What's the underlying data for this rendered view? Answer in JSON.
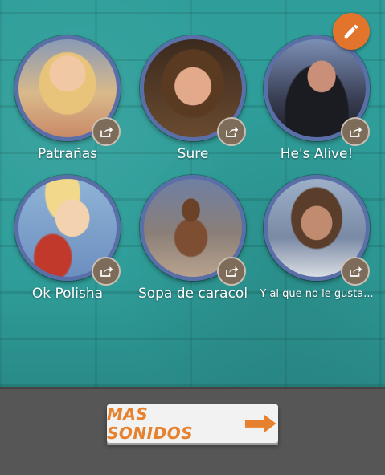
{
  "app": {
    "edit_icon": "pencil-icon",
    "accent": "#e2742b",
    "ring_color": "#5a6fa8",
    "wall_color": "#2f9e9a"
  },
  "sounds": [
    {
      "label": "Patrañas",
      "share_icon": "share-icon"
    },
    {
      "label": "Sure",
      "share_icon": "share-icon"
    },
    {
      "label": "He's Alive!",
      "share_icon": "share-icon"
    },
    {
      "label": "Ok Polisha",
      "share_icon": "share-icon"
    },
    {
      "label": "Sopa de caracol",
      "share_icon": "share-icon"
    },
    {
      "label": "Y al que no le gusta...",
      "share_icon": "share-icon"
    }
  ],
  "footer": {
    "more_label": "MAS SONIDOS",
    "more_icon": "arrow-right-icon"
  }
}
